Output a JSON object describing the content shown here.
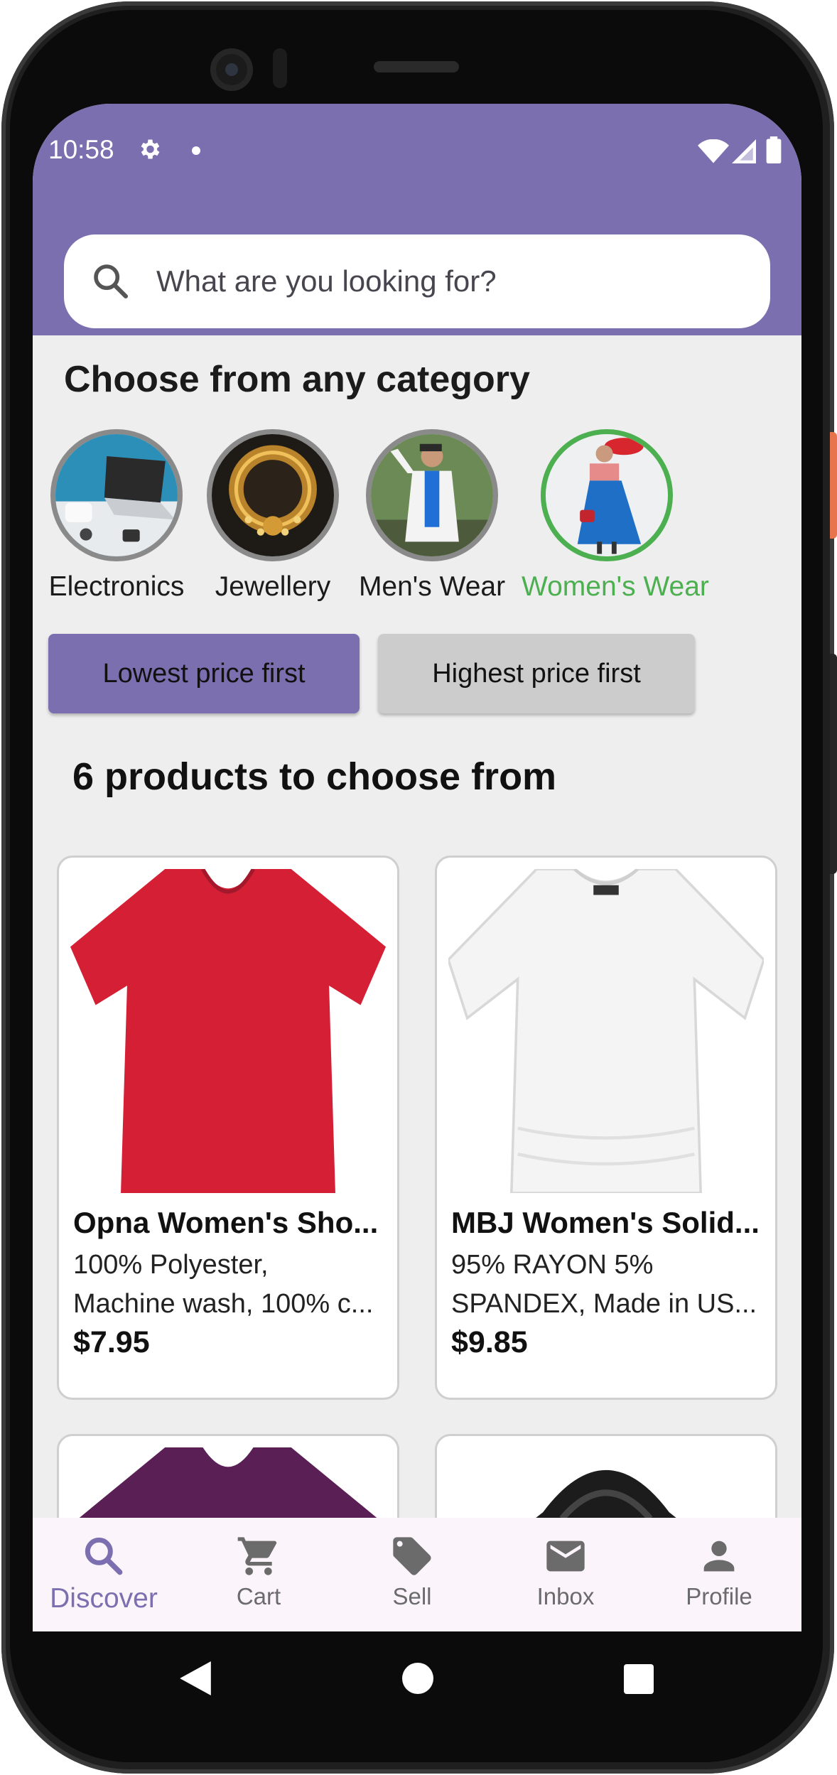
{
  "status_bar": {
    "time": "10:58"
  },
  "search": {
    "placeholder": "What are you looking for?"
  },
  "section_title": "Choose from any category",
  "categories": [
    {
      "label": "Electronics",
      "active": false
    },
    {
      "label": "Jewellery",
      "active": false
    },
    {
      "label": "Men's Wear",
      "active": false
    },
    {
      "label": "Women's Wear",
      "active": true
    }
  ],
  "sort": {
    "lowest_label": "Lowest price first",
    "highest_label": "Highest price first",
    "selected": "lowest"
  },
  "products_count_title": "6 products to choose from",
  "products": [
    {
      "title": "Opna Women's Sho...",
      "desc_line1": "100% Polyester,",
      "desc_line2": "Machine wash, 100% c...",
      "price": "$7.95"
    },
    {
      "title": "MBJ Women's Solid...",
      "desc_line1": "95% RAYON 5%",
      "desc_line2": "SPANDEX, Made in US...",
      "price": "$9.85"
    }
  ],
  "bottom_nav": [
    {
      "label": "Discover",
      "icon": "search-icon",
      "active": true
    },
    {
      "label": "Cart",
      "icon": "cart-icon",
      "active": false
    },
    {
      "label": "Sell",
      "icon": "tag-icon",
      "active": false
    },
    {
      "label": "Inbox",
      "icon": "mail-icon",
      "active": false
    },
    {
      "label": "Profile",
      "icon": "person-icon",
      "active": false
    }
  ],
  "colors": {
    "primary": "#7b6fb0",
    "active_category": "#4caf50",
    "background": "#eeeeee",
    "nav_background": "#fcf4fb"
  }
}
